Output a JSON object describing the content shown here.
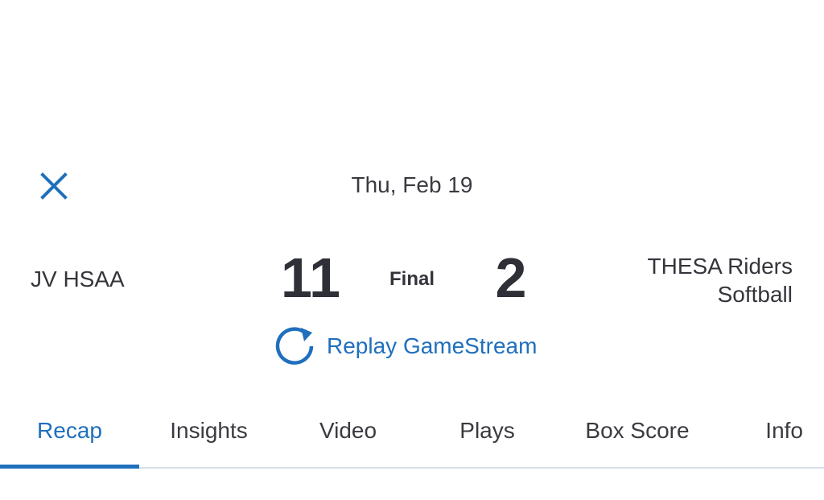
{
  "header": {
    "date": "Thu, Feb 19"
  },
  "game": {
    "home_team": "JV HSAA",
    "home_score": "11",
    "status": "Final",
    "away_score": "2",
    "away_team_line1": "THESA Riders",
    "away_team_line2": "Softball"
  },
  "replay": {
    "label": "Replay GameStream"
  },
  "tabs": [
    {
      "label": "Recap",
      "active": true
    },
    {
      "label": "Insights",
      "active": false
    },
    {
      "label": "Video",
      "active": false
    },
    {
      "label": "Plays",
      "active": false
    },
    {
      "label": "Box Score",
      "active": false
    },
    {
      "label": "Info",
      "active": false
    }
  ],
  "colors": {
    "accent": "#1f6fbd",
    "text": "#2f3037",
    "divider": "#d9dde6"
  },
  "icons": {
    "close": "close-icon",
    "replay": "replay-icon"
  }
}
